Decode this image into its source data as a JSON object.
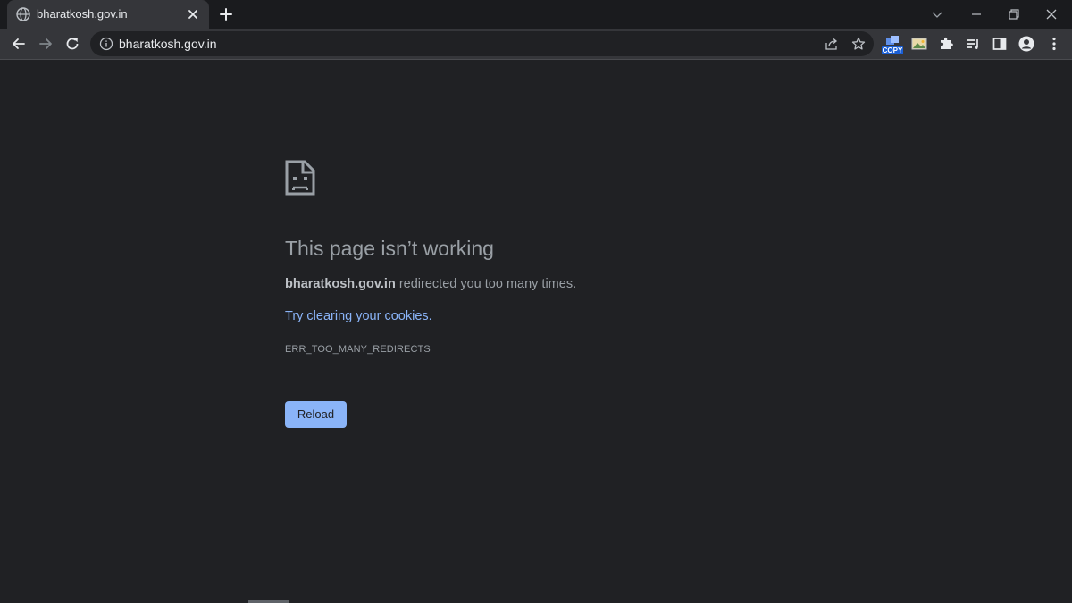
{
  "tab": {
    "title": "bharatkosh.gov.in",
    "favicon": "globe-icon",
    "close_icon": "close-icon"
  },
  "new_tab_icon": "plus-icon",
  "window_controls": [
    "chevron-down-icon",
    "minimize-icon",
    "restore-icon",
    "close-icon"
  ],
  "toolbar": {
    "back_icon": "arrow-left-icon",
    "forward_icon": "arrow-right-icon",
    "reload_icon": "reload-icon",
    "omnibox": {
      "security_icon": "info-icon",
      "url": "bharatkosh.gov.in",
      "share_icon": "share-icon",
      "bookmark_icon": "star-icon"
    },
    "extensions": {
      "copy_extension_label": "COPY",
      "image_extension_icon": "image-icon",
      "puzzle_icon": "puzzle-icon"
    },
    "reading_list_icon": "reading-list-icon",
    "side_panel_icon": "side-panel-icon",
    "profile_icon": "avatar-icon",
    "menu_icon": "kebab-menu-icon"
  },
  "error": {
    "icon": "sad-page-icon",
    "title": "This page isn’t working",
    "host": "bharatkosh.gov.in",
    "message": " redirected you too many times.",
    "suggestion_link": "Try clearing your cookies.",
    "code": "ERR_TOO_MANY_REDIRECTS",
    "reload_label": "Reload"
  },
  "colors": {
    "background": "#202124",
    "toolbar": "#35363a",
    "text": "#9aa0a6",
    "link": "#8ab4f8",
    "button": "#8ab4f8"
  }
}
